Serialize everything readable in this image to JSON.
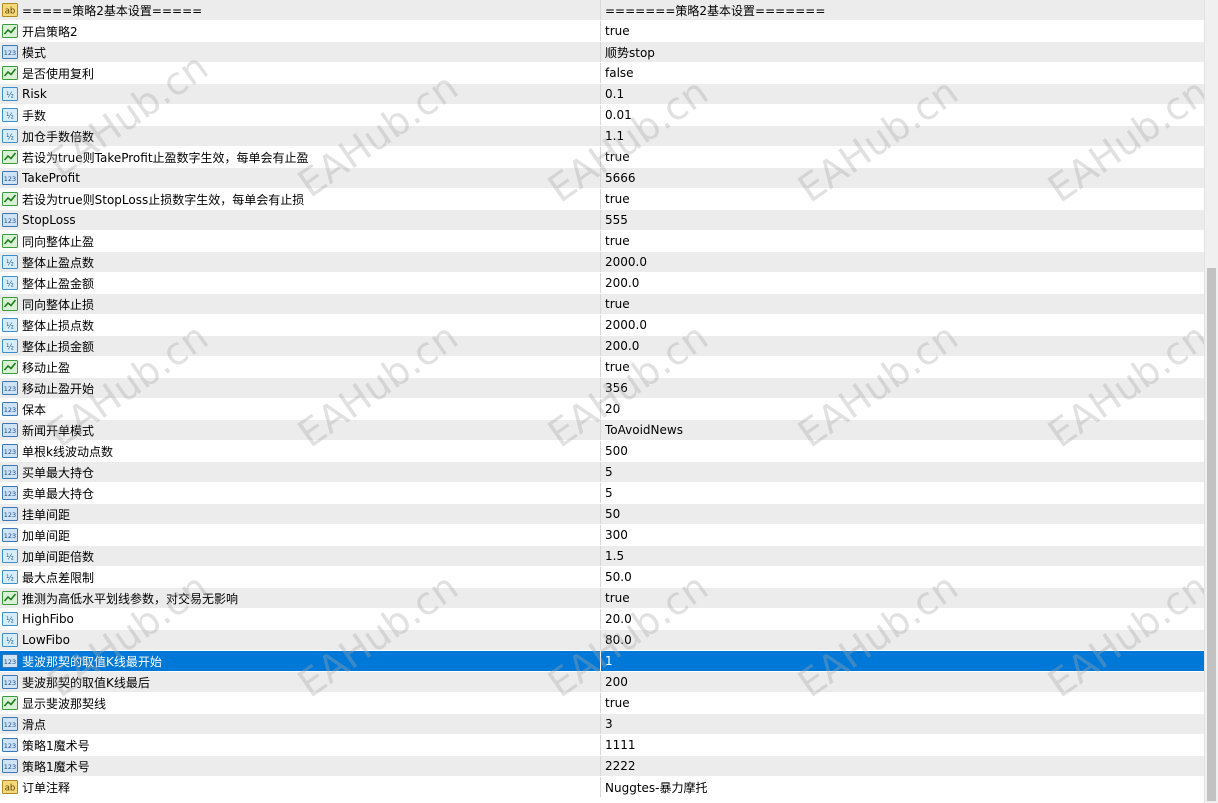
{
  "watermark": "EAHub.cn",
  "rows": [
    {
      "icon": "ab-icon",
      "name": "=====策略2基本设置=====",
      "value": "=======策略2基本设置======="
    },
    {
      "icon": "bool-icon",
      "name": "开启策略2",
      "value": "true"
    },
    {
      "icon": "int-icon",
      "name": "模式",
      "value": "顺势stop"
    },
    {
      "icon": "bool-icon",
      "name": "是否使用复利",
      "value": "false"
    },
    {
      "icon": "double-icon",
      "name": "Risk",
      "value": "0.1"
    },
    {
      "icon": "double-icon",
      "name": "手数",
      "value": "0.01"
    },
    {
      "icon": "double-icon",
      "name": "加仓手数倍数",
      "value": "1.1"
    },
    {
      "icon": "bool-icon",
      "name": "若设为true则TakeProfit止盈数字生效，每单会有止盈",
      "value": "true"
    },
    {
      "icon": "int-icon",
      "name": "TakeProfit",
      "value": "5666"
    },
    {
      "icon": "bool-icon",
      "name": "若设为true则StopLoss止损数字生效，每单会有止损",
      "value": "true"
    },
    {
      "icon": "int-icon",
      "name": "StopLoss",
      "value": "555"
    },
    {
      "icon": "bool-icon",
      "name": "同向整体止盈",
      "value": "true"
    },
    {
      "icon": "double-icon",
      "name": "整体止盈点数",
      "value": "2000.0"
    },
    {
      "icon": "double-icon",
      "name": "整体止盈金额",
      "value": "200.0"
    },
    {
      "icon": "bool-icon",
      "name": "同向整体止损",
      "value": "true"
    },
    {
      "icon": "double-icon",
      "name": "整体止损点数",
      "value": "2000.0"
    },
    {
      "icon": "double-icon",
      "name": "整体止损金额",
      "value": "200.0"
    },
    {
      "icon": "bool-icon",
      "name": "移动止盈",
      "value": "true"
    },
    {
      "icon": "int-icon",
      "name": "移动止盈开始",
      "value": "356"
    },
    {
      "icon": "int-icon",
      "name": "保本",
      "value": "20"
    },
    {
      "icon": "int-icon",
      "name": "新闻开单模式",
      "value": "ToAvoidNews"
    },
    {
      "icon": "int-icon",
      "name": "单根k线波动点数",
      "value": "500"
    },
    {
      "icon": "int-icon",
      "name": "买单最大持仓",
      "value": "5"
    },
    {
      "icon": "int-icon",
      "name": "卖单最大持仓",
      "value": "5"
    },
    {
      "icon": "int-icon",
      "name": "挂单间距",
      "value": "50"
    },
    {
      "icon": "int-icon",
      "name": "加单间距",
      "value": "300"
    },
    {
      "icon": "double-icon",
      "name": "加单间距倍数",
      "value": "1.5"
    },
    {
      "icon": "double-icon",
      "name": "最大点差限制",
      "value": "50.0"
    },
    {
      "icon": "bool-icon",
      "name": "推测为高低水平划线参数，对交易无影响",
      "value": "true"
    },
    {
      "icon": "double-icon",
      "name": "HighFibo",
      "value": "20.0"
    },
    {
      "icon": "double-icon",
      "name": "LowFibo",
      "value": "80.0"
    },
    {
      "icon": "int-icon",
      "name": "斐波那契的取值K线最开始",
      "value": "1",
      "selected": true
    },
    {
      "icon": "int-icon",
      "name": "斐波那契的取值K线最后",
      "value": "200"
    },
    {
      "icon": "bool-icon",
      "name": "显示斐波那契线",
      "value": "true"
    },
    {
      "icon": "int-icon",
      "name": "滑点",
      "value": "3"
    },
    {
      "icon": "int-icon",
      "name": "策略1魔术号",
      "value": "1111"
    },
    {
      "icon": "int-icon",
      "name": "策略1魔术号",
      "value": "2222"
    },
    {
      "icon": "ab-icon",
      "name": "订单注释",
      "value": "Nuggtes-暴力摩托"
    }
  ]
}
